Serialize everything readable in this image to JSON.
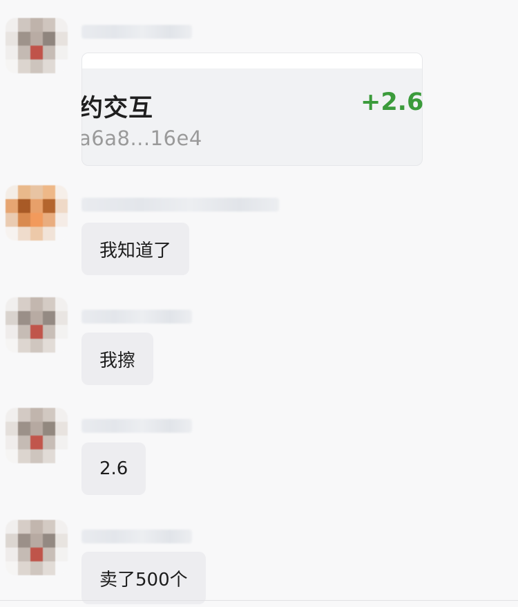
{
  "card": {
    "title": "约交互",
    "amount": "+2.62",
    "hash": "a6a8...16e4"
  },
  "messages": [
    {
      "text": "我知道了"
    },
    {
      "text": "我擦"
    },
    {
      "text": "2.6"
    },
    {
      "text": "卖了500个"
    }
  ],
  "colors": {
    "background": "#f8f8f9",
    "bubble": "#ededf0",
    "amount_positive": "#3b9b3b"
  }
}
